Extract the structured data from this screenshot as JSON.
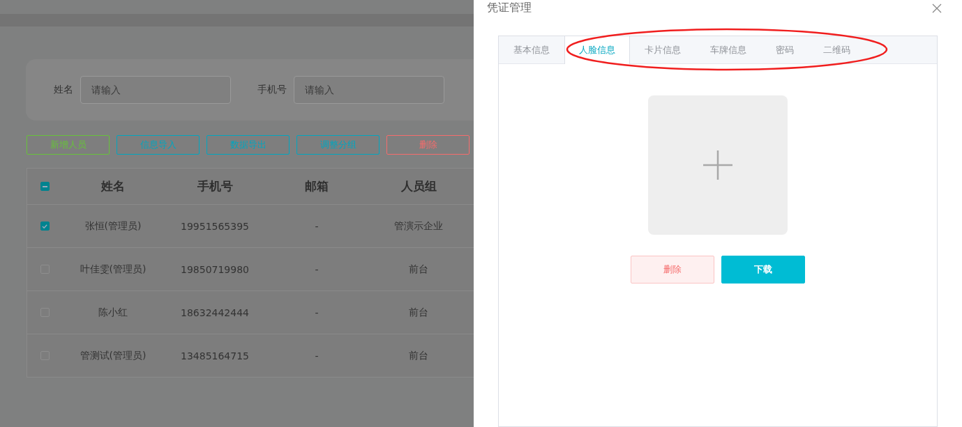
{
  "search": {
    "fields": [
      {
        "label": "姓名",
        "placeholder": "请输入"
      },
      {
        "label": "手机号",
        "placeholder": "请输入"
      }
    ]
  },
  "actions": [
    {
      "label": "新增人员",
      "color": "#67c23a"
    },
    {
      "label": "信息导入",
      "color": "#00a6c0"
    },
    {
      "label": "数据导出",
      "color": "#00a6c0"
    },
    {
      "label": "调整分组",
      "color": "#00a6c0"
    },
    {
      "label": "删除",
      "color": "#f56c6c"
    }
  ],
  "table": {
    "header_checkbox": {
      "indeterminate": true
    },
    "columns": [
      "姓名",
      "手机号",
      "邮箱",
      "人员组"
    ],
    "rows": [
      {
        "selected": true,
        "cells": [
          "张恒(管理员)",
          "19951565395",
          "-",
          "管演示企业"
        ]
      },
      {
        "selected": false,
        "cells": [
          "叶佳雯(管理员)",
          "19850719980",
          "-",
          "前台"
        ]
      },
      {
        "selected": false,
        "cells": [
          "陈小红",
          "18632442444",
          "-",
          "前台"
        ]
      },
      {
        "selected": false,
        "cells": [
          "管测试(管理员)",
          "13485164715",
          "-",
          "前台"
        ]
      }
    ]
  },
  "drawer": {
    "title": "凭证管理",
    "tabs": [
      {
        "label": "基本信息",
        "selected": false
      },
      {
        "label": "人脸信息",
        "selected": true
      },
      {
        "label": "卡片信息",
        "selected": false
      },
      {
        "label": "车牌信息",
        "selected": false
      },
      {
        "label": "密码",
        "selected": false
      },
      {
        "label": "二维码",
        "selected": false
      }
    ],
    "buttons": [
      {
        "label": "删除",
        "kind": "danger"
      },
      {
        "label": "下载",
        "kind": "primary"
      }
    ]
  }
}
